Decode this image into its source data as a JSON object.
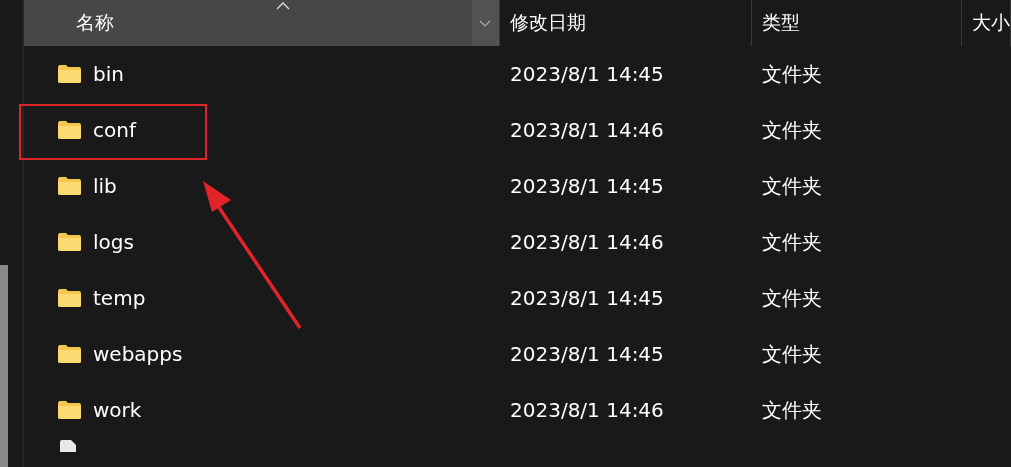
{
  "columns": [
    {
      "label": "名称",
      "sorted": true
    },
    {
      "label": "修改日期",
      "sorted": false
    },
    {
      "label": "类型",
      "sorted": false
    },
    {
      "label": "大小",
      "sorted": false
    }
  ],
  "rows": [
    {
      "kind": "folder",
      "name": "bin",
      "modified": "2023/8/1 14:45",
      "type": "文件夹",
      "highlighted": false
    },
    {
      "kind": "folder",
      "name": "conf",
      "modified": "2023/8/1 14:46",
      "type": "文件夹",
      "highlighted": true
    },
    {
      "kind": "folder",
      "name": "lib",
      "modified": "2023/8/1 14:45",
      "type": "文件夹",
      "highlighted": false
    },
    {
      "kind": "folder",
      "name": "logs",
      "modified": "2023/8/1 14:46",
      "type": "文件夹",
      "highlighted": false
    },
    {
      "kind": "folder",
      "name": "temp",
      "modified": "2023/8/1 14:45",
      "type": "文件夹",
      "highlighted": false
    },
    {
      "kind": "folder",
      "name": "webapps",
      "modified": "2023/8/1 14:45",
      "type": "文件夹",
      "highlighted": false
    },
    {
      "kind": "folder",
      "name": "work",
      "modified": "2023/8/1 14:46",
      "type": "文件夹",
      "highlighted": false
    },
    {
      "kind": "file"
    }
  ]
}
